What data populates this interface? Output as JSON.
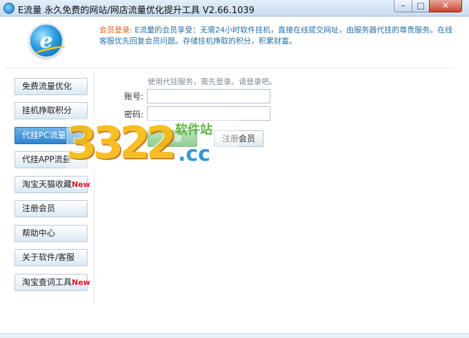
{
  "window": {
    "title": "E流量 永久免费的网站/网店流量优化提升工具 V2.66.1039",
    "min_glyph": "–",
    "max_glyph": "□",
    "close_glyph": "✕"
  },
  "header": {
    "logo_letter": "e",
    "notice_label": "会员登录:",
    "notice_text": "E流量的会员享受：无需24小时软件挂机，直接在线提交网址，由服务器代挂的尊贵服务。在线客服优先回复会员问题。存储挂机挣取的积分，积累财富。"
  },
  "sidebar": {
    "items": [
      {
        "label": "免费流量优化",
        "new": ""
      },
      {
        "label": "挂机挣取积分",
        "new": ""
      },
      {
        "label": "代挂PC流量",
        "new": ""
      },
      {
        "label": "代挂APP流量",
        "new": ""
      },
      {
        "label": "淘宝天猫收藏",
        "new": "New"
      },
      {
        "label": "注册会员",
        "new": ""
      },
      {
        "label": "帮助中心",
        "new": ""
      },
      {
        "label": "关于软件/客服",
        "new": ""
      },
      {
        "label": "淘宝查词工具",
        "new": "New"
      }
    ],
    "active_index": 2
  },
  "login": {
    "hint": "使用代挂服务，需先登录。请登录吧。",
    "account_label": "账号:",
    "password_label": "密码:",
    "account_value": "",
    "password_value": "",
    "login_button": "登 录",
    "register_button": "注册会员"
  },
  "watermark": {
    "number": "3322",
    "suffix": ".cc",
    "site": "软件站"
  },
  "colors": {
    "accent_blue": "#2e83cf",
    "notice_label": "#e25c1e",
    "new_badge": "#e0162b",
    "login_green": "#38a43b"
  }
}
